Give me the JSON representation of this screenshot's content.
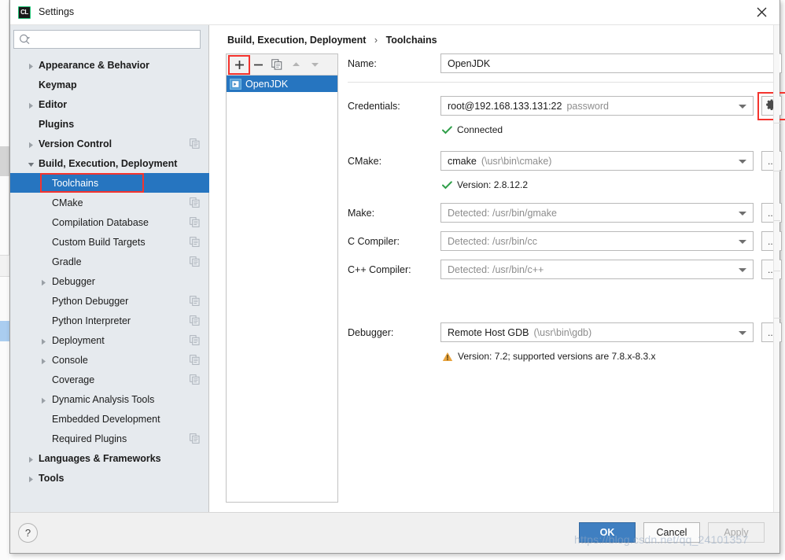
{
  "window": {
    "title": "Settings",
    "app_icon": "clion-icon",
    "close_icon": "close-icon"
  },
  "sidebar": {
    "search": {
      "placeholder": "",
      "value": "",
      "icon": "search-icon"
    },
    "items": [
      {
        "label": "Appearance & Behavior",
        "level": 0,
        "bold": true,
        "arrow": "right",
        "badge": false,
        "selected": false
      },
      {
        "label": "Keymap",
        "level": 0,
        "bold": true,
        "arrow": "none",
        "badge": false,
        "selected": false
      },
      {
        "label": "Editor",
        "level": 0,
        "bold": true,
        "arrow": "right",
        "badge": false,
        "selected": false
      },
      {
        "label": "Plugins",
        "level": 0,
        "bold": true,
        "arrow": "none",
        "badge": false,
        "selected": false
      },
      {
        "label": "Version Control",
        "level": 0,
        "bold": true,
        "arrow": "right",
        "badge": true,
        "selected": false
      },
      {
        "label": "Build, Execution, Deployment",
        "level": 0,
        "bold": true,
        "arrow": "down",
        "badge": false,
        "selected": false
      },
      {
        "label": "Toolchains",
        "level": 1,
        "bold": false,
        "arrow": "none",
        "badge": false,
        "selected": true
      },
      {
        "label": "CMake",
        "level": 1,
        "bold": false,
        "arrow": "none",
        "badge": true,
        "selected": false
      },
      {
        "label": "Compilation Database",
        "level": 1,
        "bold": false,
        "arrow": "none",
        "badge": true,
        "selected": false
      },
      {
        "label": "Custom Build Targets",
        "level": 1,
        "bold": false,
        "arrow": "none",
        "badge": true,
        "selected": false
      },
      {
        "label": "Gradle",
        "level": 1,
        "bold": false,
        "arrow": "none",
        "badge": true,
        "selected": false
      },
      {
        "label": "Debugger",
        "level": 1,
        "bold": false,
        "arrow": "right",
        "badge": false,
        "selected": false
      },
      {
        "label": "Python Debugger",
        "level": 1,
        "bold": false,
        "arrow": "none",
        "badge": true,
        "selected": false
      },
      {
        "label": "Python Interpreter",
        "level": 1,
        "bold": false,
        "arrow": "none",
        "badge": true,
        "selected": false
      },
      {
        "label": "Deployment",
        "level": 1,
        "bold": false,
        "arrow": "right",
        "badge": true,
        "selected": false
      },
      {
        "label": "Console",
        "level": 1,
        "bold": false,
        "arrow": "right",
        "badge": true,
        "selected": false
      },
      {
        "label": "Coverage",
        "level": 1,
        "bold": false,
        "arrow": "none",
        "badge": true,
        "selected": false
      },
      {
        "label": "Dynamic Analysis Tools",
        "level": 1,
        "bold": false,
        "arrow": "right",
        "badge": false,
        "selected": false
      },
      {
        "label": "Embedded Development",
        "level": 1,
        "bold": false,
        "arrow": "none",
        "badge": false,
        "selected": false
      },
      {
        "label": "Required Plugins",
        "level": 1,
        "bold": false,
        "arrow": "none",
        "badge": true,
        "selected": false
      },
      {
        "label": "Languages & Frameworks",
        "level": 0,
        "bold": true,
        "arrow": "right",
        "badge": false,
        "selected": false
      },
      {
        "label": "Tools",
        "level": 0,
        "bold": true,
        "arrow": "right",
        "badge": false,
        "selected": false
      }
    ]
  },
  "content": {
    "breadcrumb": {
      "root": "Build, Execution, Deployment",
      "separator": "›",
      "leaf": "Toolchains"
    },
    "toolchain_list": {
      "toolbar": [
        {
          "name": "add-toolchain-button",
          "glyph": "+",
          "highlighted": true
        },
        {
          "name": "remove-toolchain-button",
          "glyph": "−",
          "highlighted": false
        },
        {
          "name": "copy-toolchain-button",
          "glyph": "copy-icon",
          "highlighted": false
        },
        {
          "name": "move-up-button",
          "glyph": "up-arrow-icon",
          "highlighted": false
        },
        {
          "name": "move-down-button",
          "glyph": "down-arrow-icon",
          "highlighted": false
        }
      ],
      "rows": [
        {
          "label": "OpenJDK",
          "selected": true,
          "icon": "toolchain-icon"
        }
      ]
    },
    "form": {
      "name": {
        "label": "Name:",
        "value": "OpenJDK"
      },
      "credentials": {
        "label": "Credentials:",
        "value": "root@192.168.133.131:22",
        "value_suffix": "password",
        "status_icon": "check-icon",
        "status_text": "Connected",
        "status_color": "#2e9e48",
        "gear_icon": "gear-icon",
        "gear_highlighted": true
      },
      "cmake": {
        "label": "CMake:",
        "value": "cmake",
        "value_suffix": "(\\usr\\bin\\cmake)",
        "status_icon": "check-icon",
        "status_text": "Version: 2.8.12.2",
        "status_color": "#2e9e48",
        "browse_label": "..."
      },
      "make": {
        "label": "Make:",
        "value": "Detected: /usr/bin/gmake",
        "muted": true,
        "browse_label": "..."
      },
      "c_compiler": {
        "label": "C Compiler:",
        "value": "Detected: /usr/bin/cc",
        "muted": true,
        "browse_label": "..."
      },
      "cpp_compiler": {
        "label": "C++ Compiler:",
        "value": "Detected: /usr/bin/c++",
        "muted": true,
        "browse_label": "..."
      },
      "debugger": {
        "label": "Debugger:",
        "value": "Remote Host GDB",
        "value_suffix": "(\\usr\\bin\\gdb)",
        "status_icon": "warning-icon",
        "status_text": "Version: 7.2; supported versions are 7.8.x-8.3.x",
        "status_color": "#e8a33d",
        "browse_label": "..."
      }
    }
  },
  "footer": {
    "help_label": "?",
    "ok_label": "OK",
    "cancel_label": "Cancel",
    "apply_label": "Apply"
  },
  "watermark": "https://blog.csdn.net/qq_24101357",
  "colors": {
    "selection_blue": "#2675c0",
    "primary_button": "#3f7fc1",
    "highlight_red": "#f4342e",
    "sidebar_bg": "#e6eaee",
    "success_green": "#2e9e48",
    "warning_orange": "#e8a33d"
  }
}
